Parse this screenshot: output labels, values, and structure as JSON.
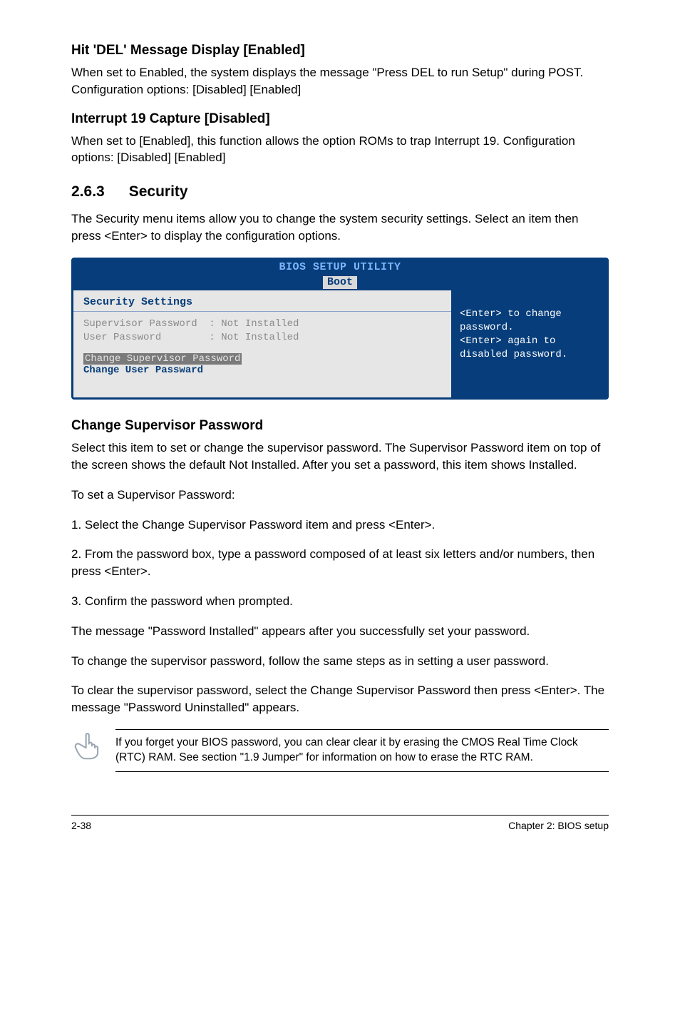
{
  "s1": {
    "heading": "Hit 'DEL' Message Display [Enabled]",
    "body": "When set to Enabled, the system displays the message \"Press DEL to run Setup\" during POST. Configuration options: [Disabled] [Enabled]"
  },
  "s2": {
    "heading": "Interrupt 19 Capture [Disabled]",
    "body": "When set to [Enabled], this function allows the option ROMs to trap Interrupt 19. Configuration options: [Disabled] [Enabled]"
  },
  "sec": {
    "num": "2.6.3",
    "title": "Security",
    "intro": "The Security menu items allow you to change the system security settings. Select an item then press <Enter> to display the configuration options."
  },
  "bios": {
    "title1": "BIOS SETUP UTILITY",
    "title2": "Boot",
    "left_heading": "Security Settings",
    "line1": "Supervisor Password  : Not Installed",
    "line2": "User Password        : Not Installed",
    "selected": "Change Supervisor Password",
    "link": "Change User Passward",
    "help": "<Enter> to change password.\n<Enter> again to disabled password."
  },
  "csp": {
    "heading": "Change Supervisor Password",
    "p1": "Select this item to set or change the supervisor password. The Supervisor Password item on top of the screen shows the default Not Installed. After you set a password, this item shows Installed.",
    "p2": "To set a Supervisor Password:",
    "p3": "1. Select the Change Supervisor Password item and press <Enter>.",
    "p4": "2. From the password box, type a password composed of at least six letters and/or numbers, then press <Enter>.",
    "p5": "3. Confirm the password when prompted.",
    "p6": "The message \"Password Installed\" appears after you successfully set your password.",
    "p7": "To change the supervisor password, follow the same steps as in setting a user password.",
    "p8": "To clear the supervisor password, select the Change Supervisor Password then press <Enter>. The message \"Password Uninstalled\" appears."
  },
  "note": {
    "text": "If you forget your BIOS password, you can clear clear it by erasing the CMOS Real Time Clock (RTC) RAM. See section \"1.9 Jumper\" for information on how to erase the RTC RAM."
  },
  "footer": {
    "left": "2-38",
    "right": "Chapter 2: BIOS setup"
  }
}
